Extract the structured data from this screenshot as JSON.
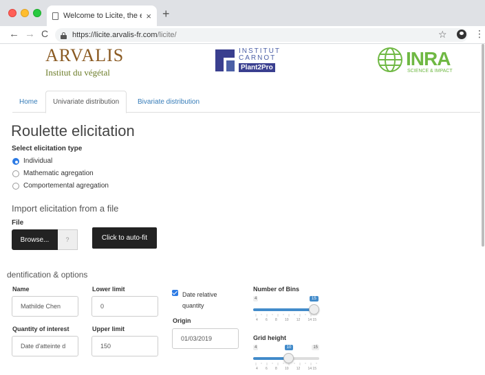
{
  "browser": {
    "tab_title": "Welcome to Licite, the easy-to",
    "tab_close": "×",
    "new_tab": "+",
    "url_host": "https://licite.arvalis-fr.com",
    "url_path": "/licite/"
  },
  "logos": {
    "arvalis": {
      "name": "ARVALIS",
      "tagline": "Institut du végétal"
    },
    "carnot": {
      "line1": "INSTITUT",
      "line2": "CARNOT",
      "badge": "Plant2Pro"
    },
    "inra": {
      "name": "INRA",
      "tagline": "SCIENCE & IMPACT"
    }
  },
  "nav": {
    "tabs": [
      {
        "label": "Home",
        "active": false
      },
      {
        "label": "Univariate distribution",
        "active": true
      },
      {
        "label": "Bivariate distribution",
        "active": false
      }
    ]
  },
  "main": {
    "title": "Roulette elicitation",
    "elicitation_type": {
      "label": "Select elicitation type",
      "options": [
        {
          "label": "Individual",
          "checked": true
        },
        {
          "label": "Mathematic agregation",
          "checked": false
        },
        {
          "label": "Comportemental agregation",
          "checked": false
        }
      ]
    },
    "import": {
      "heading": "Import elicitation from a file",
      "file_label": "File",
      "browse_label": "Browse...",
      "file_value": "?",
      "autofit_label": "Click to auto-fit"
    },
    "identification": {
      "heading": "dentification & options",
      "name_label": "Name",
      "name_value": "Mathilde Chen",
      "quantity_label": "Quantity of interest",
      "quantity_value": "Date d'atteinte d",
      "lower_label": "Lower limit",
      "lower_value": "0",
      "upper_label": "Upper limit",
      "upper_value": "150",
      "date_relative_label": "Date relative quantity",
      "date_relative_checked": true,
      "origin_label": "Origin",
      "origin_value": "01/03/2019",
      "bins": {
        "label": "Number of Bins",
        "min": "4",
        "max": "15",
        "value": "15",
        "fraction": 1.0,
        "tick_labels": [
          "4",
          "6",
          "8",
          "10",
          "12",
          "14 15"
        ]
      },
      "grid": {
        "label": "Grid height",
        "min": "4",
        "max": "15",
        "value": "10",
        "fraction": 0.545,
        "tick_labels": [
          "4",
          "6",
          "8",
          "10",
          "12",
          "14 15"
        ]
      }
    }
  },
  "colors": {
    "accent": "#2d7be5",
    "link": "#337ab7",
    "slider": "#428bca",
    "button_dark": "#222222"
  },
  "icons": [
    "page-icon",
    "lock-icon",
    "star-icon",
    "account-icon",
    "menu-icon",
    "back-icon",
    "forward-icon",
    "reload-icon"
  ]
}
